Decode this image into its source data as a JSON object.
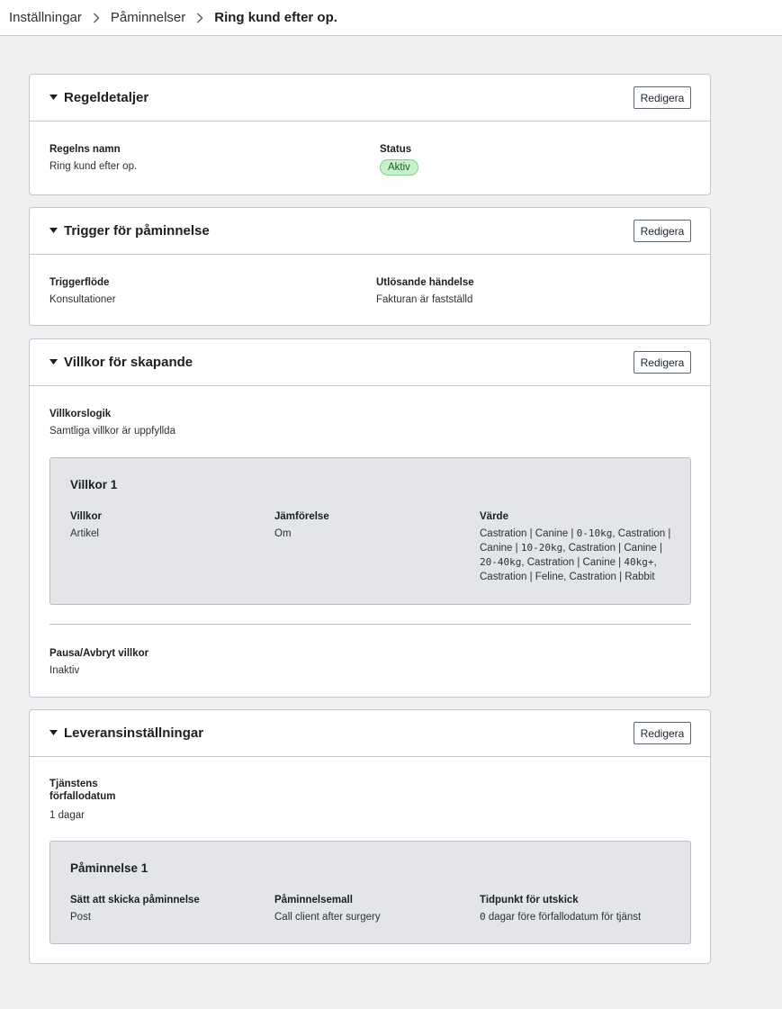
{
  "breadcrumb": {
    "items": [
      "Inställningar",
      "Påminnelser"
    ],
    "current": "Ring kund efter op."
  },
  "edit_label": "Redigera",
  "rule_details": {
    "title": "Regeldetaljer",
    "name_label": "Regelns namn",
    "name_value": "Ring kund efter op.",
    "status_label": "Status",
    "status_value": "Aktiv"
  },
  "trigger": {
    "title": "Trigger för påminnelse",
    "flow_label": "Triggerflöde",
    "flow_value": "Konsultationer",
    "event_label": "Utlösande händelse",
    "event_value": "Fakturan är fastställd"
  },
  "conditions": {
    "title": "Villkor för skapande",
    "logic_label": "Villkorslogik",
    "logic_value": "Samtliga villkor är uppfyllda",
    "condition_title": "Villkor 1",
    "col_condition": "Villkor",
    "col_comparison": "Jämförelse",
    "col_value": "Värde",
    "condition_value": "Artikel",
    "comparison_value": "Om",
    "value_lines": [
      [
        "Castration | Canine | ",
        "0-10kg",
        ", Castration |"
      ],
      [
        "Canine | ",
        "10-20kg",
        ", Castration | Canine |"
      ],
      [
        "",
        "20-40kg",
        ", Castration | Canine | ",
        "40kg+",
        ","
      ],
      [
        "Castration | Feline, Castration | Rabbit"
      ]
    ],
    "pause_label": "Pausa/Avbryt villkor",
    "pause_value": "Inaktiv"
  },
  "delivery": {
    "title": "Leveransinställningar",
    "due_label_line1": "Tjänstens",
    "due_label_line2": "förfallodatum",
    "due_value": "1 dagar",
    "reminder_title": "Påminnelse 1",
    "col_method": "Sätt att skicka påminnelse",
    "col_template": "Påminnelsemall",
    "col_timing": "Tidpunkt för utskick",
    "method_value": "Post",
    "template_value": "Call client after surgery",
    "timing_number": "0",
    "timing_text": " dagar före förfallodatum för tjänst"
  }
}
